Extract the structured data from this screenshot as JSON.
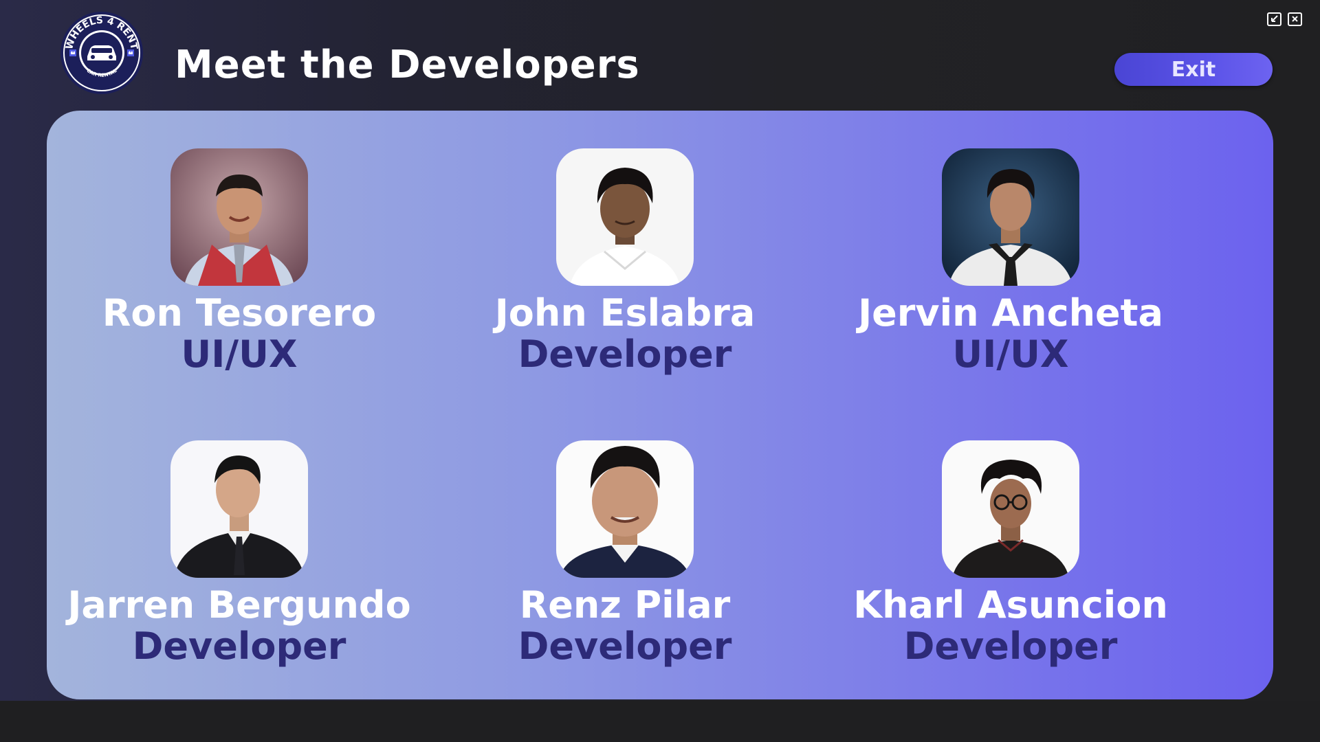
{
  "app": {
    "logo_text_top": "WHEELS 4 RENT",
    "logo_text_bottom": "CAR RENTAL"
  },
  "header": {
    "title": "Meet the Developers",
    "exit_label": "Exit"
  },
  "window_controls": {
    "minimize_icon": "minimize-icon",
    "close_icon": "close-icon"
  },
  "colors": {
    "background": "#222226",
    "panel_start": "#a3b4dc",
    "panel_end": "#6c62ee",
    "role_text": "#2d2a78",
    "exit_button": "#5b53e8"
  },
  "developers": [
    {
      "name": "Ron Tesorero",
      "role": "UI/UX"
    },
    {
      "name": "John Eslabra",
      "role": "Developer"
    },
    {
      "name": "Jervin Ancheta",
      "role": "UI/UX"
    },
    {
      "name": "Jarren Bergundo",
      "role": "Developer"
    },
    {
      "name": "Renz Pilar",
      "role": "Developer"
    },
    {
      "name": "Kharl Asuncion",
      "role": "Developer"
    }
  ]
}
